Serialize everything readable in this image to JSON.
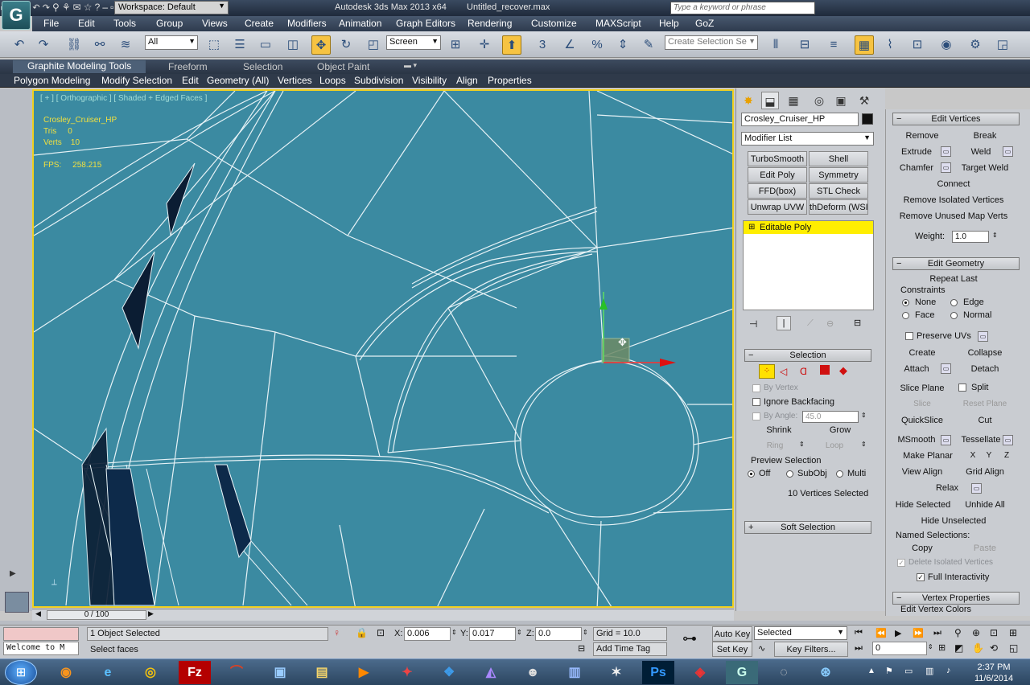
{
  "window": {
    "app_icon": "3ds-max-logo",
    "workspace": "Workspace: Default",
    "title": "Autodesk 3ds Max 2013 x64",
    "file": "Untitled_recover.max",
    "search_placeholder": "Type a keyword or phrase"
  },
  "menubar": [
    "File",
    "Edit",
    "Tools",
    "Group",
    "Views",
    "Create",
    "Modifiers",
    "Animation",
    "Graph Editors",
    "Rendering",
    "Customize",
    "MAXScript",
    "Help",
    "GoZ"
  ],
  "toolbar": {
    "filter": "All",
    "ref_coord": "Screen",
    "named_selection_placeholder": "Create Selection Se"
  },
  "ribbon": {
    "tabs": [
      "Graphite Modeling Tools",
      "Freeform",
      "Selection",
      "Object Paint"
    ],
    "panels": [
      "Polygon Modeling",
      "Modify Selection",
      "Edit",
      "Geometry (All)",
      "Vertices",
      "Loops",
      "Subdivision",
      "Visibility",
      "Align",
      "Properties"
    ]
  },
  "viewport": {
    "label": "[ + ] [ Orthographic ] [ Shaded + Edged Faces ]",
    "info_name": "Crosley_Cruiser_HP",
    "info_tris_label": "Tris",
    "info_tris": "0",
    "info_verts_label": "Verts",
    "info_verts": "10",
    "info_fps_label": "FPS:",
    "info_fps": "258.215"
  },
  "command_panel": {
    "object_name": "Crosley_Cruiser_HP",
    "object_color": "#111111",
    "modifier_list": "Modifier List",
    "modifier_buttons": [
      "TurboSmooth",
      "Shell",
      "Edit Poly",
      "Symmetry",
      "FFD(box)",
      "STL Check",
      "Unwrap UVW",
      "thDeform (WSI"
    ],
    "stack_item": "Editable Poly",
    "selection": {
      "header": "Selection",
      "by_vertex": "By Vertex",
      "ignore_backfacing": "Ignore Backfacing",
      "by_angle": "By Angle:",
      "angle_value": "45.0",
      "shrink": "Shrink",
      "grow": "Grow",
      "ring": "Ring",
      "loop": "Loop",
      "preview_label": "Preview Selection",
      "preview_off": "Off",
      "preview_subobj": "SubObj",
      "preview_multi": "Multi",
      "status": "10 Vertices Selected"
    },
    "soft_selection": "Soft Selection"
  },
  "edit_vertices": {
    "header": "Edit Vertices",
    "remove": "Remove",
    "break": "Break",
    "extrude": "Extrude",
    "weld": "Weld",
    "chamfer": "Chamfer",
    "target_weld": "Target Weld",
    "connect": "Connect",
    "remove_isolated": "Remove Isolated Vertices",
    "remove_unused": "Remove Unused Map Verts",
    "weight_label": "Weight:",
    "weight_value": "1.0"
  },
  "edit_geometry": {
    "header": "Edit Geometry",
    "repeat_last": "Repeat Last",
    "constraints": "Constraints",
    "none": "None",
    "edge": "Edge",
    "face": "Face",
    "normal": "Normal",
    "preserve_uvs": "Preserve UVs",
    "create": "Create",
    "collapse": "Collapse",
    "attach": "Attach",
    "detach": "Detach",
    "slice_plane": "Slice Plane",
    "split": "Split",
    "slice": "Slice",
    "reset_plane": "Reset Plane",
    "quickslice": "QuickSlice",
    "cut": "Cut",
    "msmooth": "MSmooth",
    "tessellate": "Tessellate",
    "make_planar": "Make Planar",
    "x": "X",
    "y": "Y",
    "z": "Z",
    "view_align": "View Align",
    "grid_align": "Grid Align",
    "relax": "Relax",
    "hide_selected": "Hide Selected",
    "unhide_all": "Unhide All",
    "hide_unselected": "Hide Unselected",
    "named_selections": "Named Selections:",
    "copy": "Copy",
    "paste": "Paste",
    "delete_isolated": "Delete Isolated Vertices",
    "full_interactivity": "Full Interactivity"
  },
  "vertex_properties": "Vertex Properties",
  "edit_vertex_colors": "Edit Vertex Colors",
  "timeline": {
    "frame": "0 / 100"
  },
  "status": {
    "objects_selected": "1 Object Selected",
    "prompt": "Select faces",
    "maxscript": "Welcome to M",
    "x_label": "X:",
    "x": "0.006",
    "y_label": "Y:",
    "y": "0.017",
    "z_label": "Z:",
    "z": "0.0",
    "grid": "Grid = 10.0",
    "add_time_tag": "Add Time Tag",
    "auto_key": "Auto Key",
    "set_key": "Set Key",
    "selected": "Selected",
    "key_filters": "Key Filters...",
    "frame_field": "0"
  },
  "taskbar": {
    "apps": [
      "firefox-icon",
      "ie-icon",
      "chrome-icon",
      "filezilla-icon",
      "app-icon",
      "vlc-icon",
      "explorer-icon",
      "media-icon",
      "app-icon",
      "dropbox-icon",
      "app-icon",
      "app-icon",
      "app-icon",
      "app-icon",
      "photoshop-icon",
      "app-icon",
      "3dsmax-icon",
      "app-icon",
      "app-icon"
    ],
    "time": "2:37 PM",
    "date": "11/6/2014"
  },
  "colors": {
    "accent": "#f6c342",
    "viewport_bg": "#3b8aa1",
    "stack_highlight": "#ffee00"
  }
}
